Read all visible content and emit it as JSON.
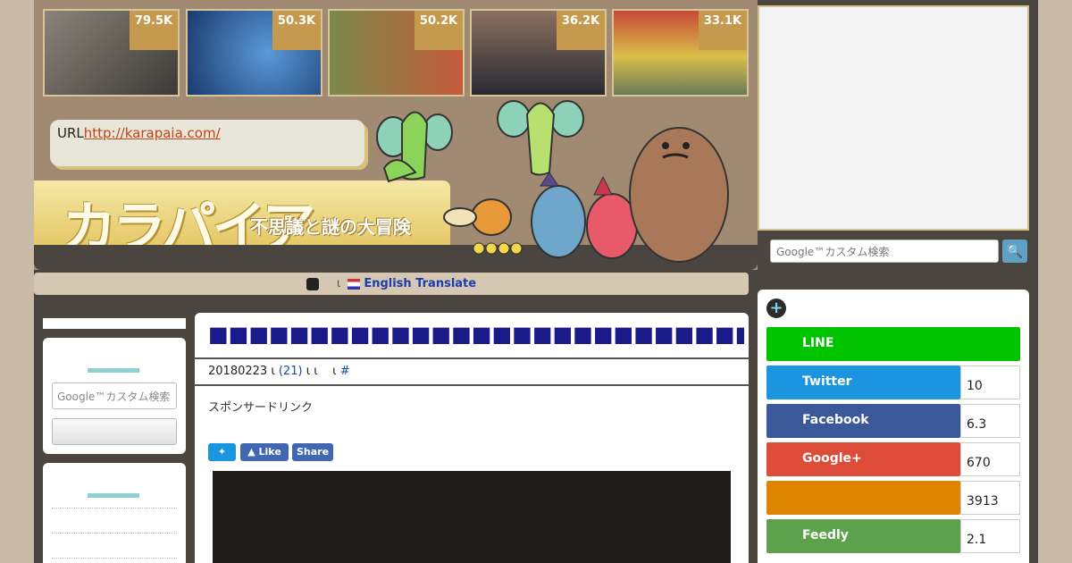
{
  "thumbnails": [
    {
      "count": "79.5K",
      "colors": [
        "#6b6660",
        "#3d3a36"
      ]
    },
    {
      "count": "50.3K",
      "colors": [
        "#3d73b8",
        "#1a3a6e"
      ]
    },
    {
      "count": "50.2K",
      "colors": [
        "#7a8a4a",
        "#c45a3a"
      ]
    },
    {
      "count": "36.2K",
      "colors": [
        "#3a3a44",
        "#8a7060"
      ]
    },
    {
      "count": "33.1K",
      "colors": [
        "#7a8a6a",
        "#d8c048"
      ]
    }
  ],
  "header": {
    "url_label": "URL",
    "url_link": "http://karapaia.com/",
    "logo_text": "カラパイア",
    "logo_subtitle": "不思議と謎の大冒険"
  },
  "translate": {
    "sep": "ι",
    "label": "English Translate"
  },
  "search": {
    "placeholder": "Google™カスタム検索",
    "button_icon": "search-icon"
  },
  "article": {
    "title": "■■■■■■■■■■■■■■■■■■■■■■■■■■■■■■■■■■■■■■■■",
    "date": "20180223",
    "sep1": "ι",
    "comments": "(21)",
    "sep2": "ι",
    "sep3": "ι",
    "sep4": "ι",
    "tag": "#",
    "sponsor": "スポンサードリンク",
    "sns": {
      "like": "Like",
      "share": "Share"
    }
  },
  "share_buttons": [
    {
      "label": "LINE",
      "count": "",
      "color": "#00c300"
    },
    {
      "label": "Twitter",
      "count": "10",
      "color": "#1b95e0"
    },
    {
      "label": "Facebook",
      "count": "6.3",
      "color": "#3b5998"
    },
    {
      "label": "Google+",
      "count": "670",
      "color": "#dd4b39"
    },
    {
      "label": "",
      "count": "3913",
      "color": "#dd8400"
    },
    {
      "label": "Feedly",
      "count": "2.1",
      "color": "#5ea14c"
    }
  ]
}
